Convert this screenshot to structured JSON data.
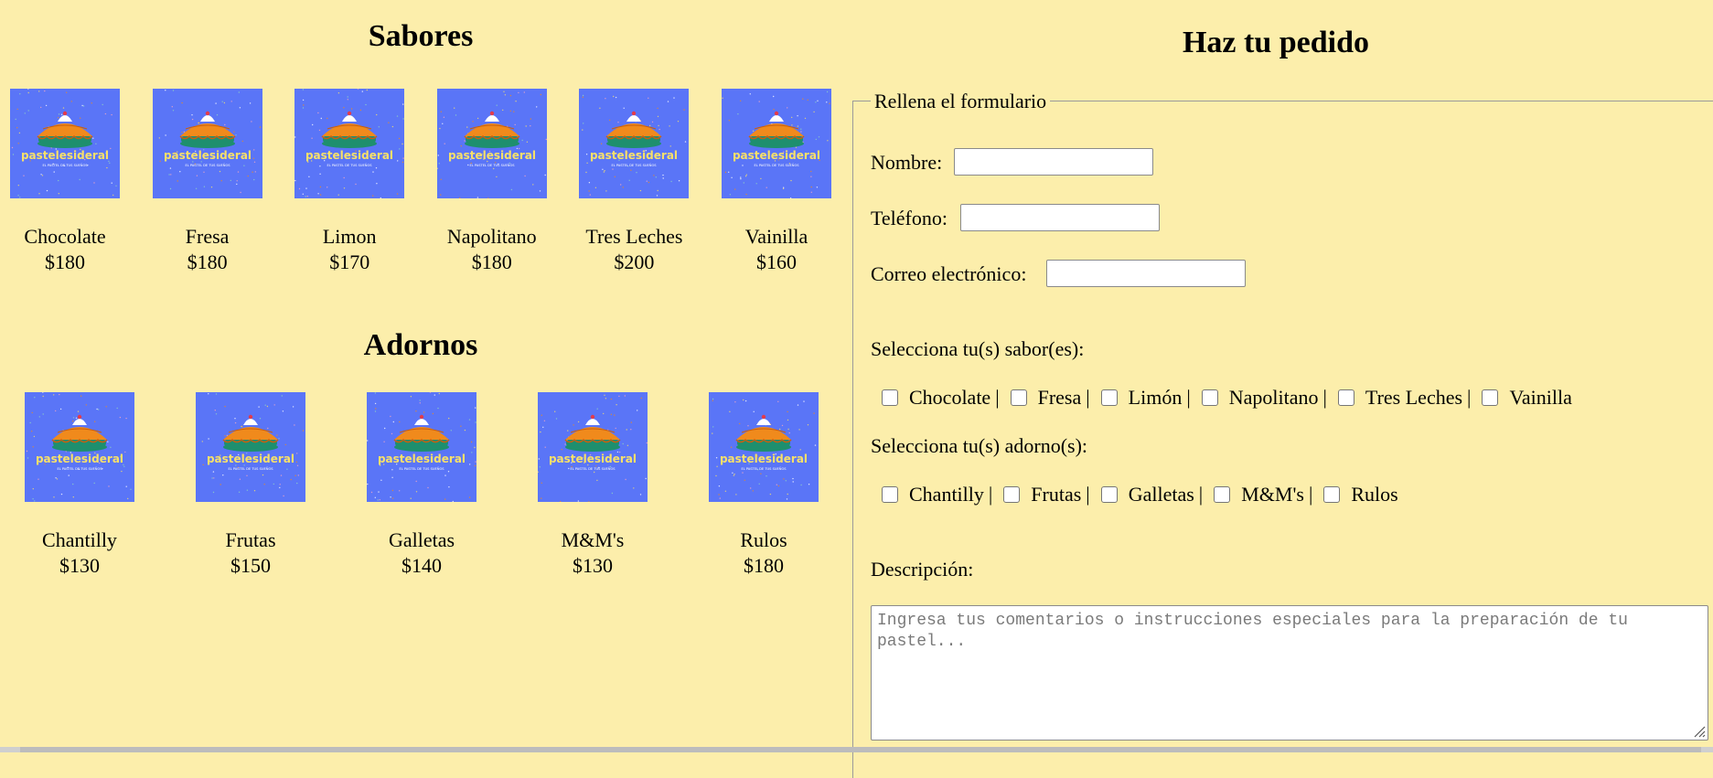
{
  "sabores": {
    "title": "Sabores",
    "items": [
      {
        "name": "Chocolate",
        "price": "$180",
        "logo": "pastelesideral",
        "tagline": "EL PASTEL DE TUS SUEÑOS"
      },
      {
        "name": "Fresa",
        "price": "$180",
        "logo": "pastelesideral",
        "tagline": "EL PASTEL DE TUS SUEÑOS"
      },
      {
        "name": "Limon",
        "price": "$170",
        "logo": "pastelesideral",
        "tagline": "EL PASTEL DE TUS SUEÑOS"
      },
      {
        "name": "Napolitano",
        "price": "$180",
        "logo": "pastelesideral",
        "tagline": "EL PASTEL DE TUS SUEÑOS"
      },
      {
        "name": "Tres Leches",
        "price": "$200",
        "logo": "pastelesideral",
        "tagline": "EL PASTEL DE TUS SUEÑOS"
      },
      {
        "name": "Vainilla",
        "price": "$160",
        "logo": "pastelesideral",
        "tagline": "EL PASTEL DE TUS SUEÑOS"
      }
    ]
  },
  "adornos": {
    "title": "Adornos",
    "items": [
      {
        "name": "Chantilly",
        "price": "$130",
        "logo": "pastelesideral",
        "tagline": "EL PASTEL DE TUS SUEÑOS"
      },
      {
        "name": "Frutas",
        "price": "$150",
        "logo": "pastelesideral",
        "tagline": "EL PASTEL DE TUS SUEÑOS"
      },
      {
        "name": "Galletas",
        "price": "$140",
        "logo": "pastelesideral",
        "tagline": "EL PASTEL DE TUS SUEÑOS"
      },
      {
        "name": "M&M's",
        "price": "$130",
        "logo": "pastelesideral",
        "tagline": "EL PASTEL DE TUS SUEÑOS"
      },
      {
        "name": "Rulos",
        "price": "$180",
        "logo": "pastelesideral",
        "tagline": "EL PASTEL DE TUS SUEÑOS"
      }
    ]
  },
  "order": {
    "title": "Haz tu pedido",
    "legend": "Rellena el formulario",
    "nombre_label": "Nombre:",
    "nombre_value": "",
    "telefono_label": "Teléfono:",
    "telefono_value": "",
    "correo_label": "Correo electrónico:",
    "correo_value": "",
    "sabores_label": "Selecciona tu(s) sabor(es):",
    "sabores_options": [
      {
        "label": "Chocolate",
        "checked": false
      },
      {
        "label": "Fresa",
        "checked": false
      },
      {
        "label": "Limón",
        "checked": false
      },
      {
        "label": "Napolitano",
        "checked": false
      },
      {
        "label": "Tres Leches",
        "checked": false
      },
      {
        "label": "Vainilla",
        "checked": false
      }
    ],
    "adornos_label": "Selecciona tu(s) adorno(s):",
    "adornos_options": [
      {
        "label": "Chantilly",
        "checked": false
      },
      {
        "label": "Frutas",
        "checked": false
      },
      {
        "label": "Galletas",
        "checked": false
      },
      {
        "label": "M&M's",
        "checked": false
      },
      {
        "label": "Rulos",
        "checked": false
      }
    ],
    "separator": "|",
    "descripcion_label": "Descripción:",
    "descripcion_placeholder": "Ingresa tus comentarios o instrucciones especiales para la preparación de tu pastel..."
  },
  "colors": {
    "background": "#FCEEAB",
    "thumb_bg": "#5A75F7",
    "logo_text": "#F7E06A",
    "pie_orange": "#F08A1C",
    "pie_green": "#1E8F6E"
  }
}
